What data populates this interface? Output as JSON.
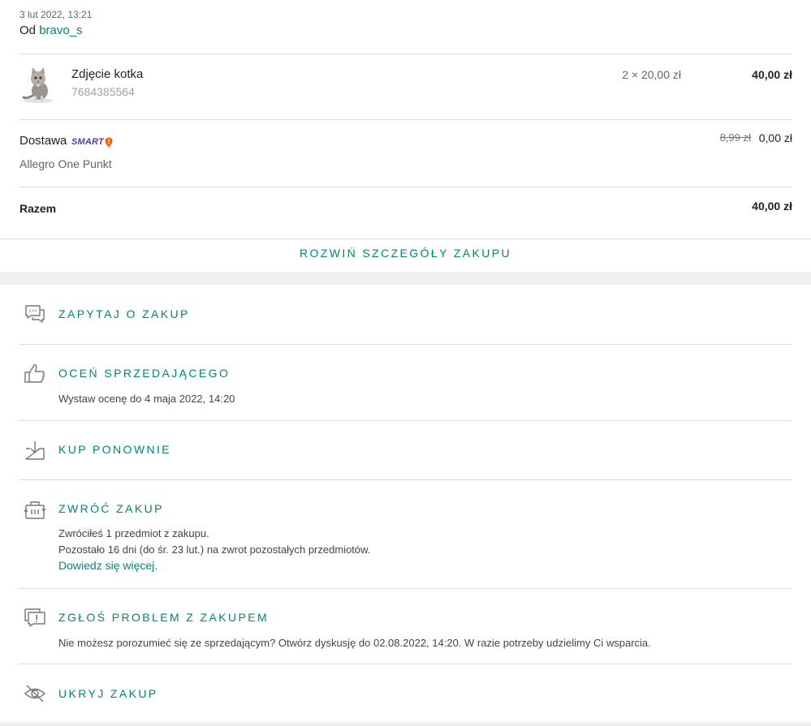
{
  "order": {
    "date": "3 lut 2022, 13:21",
    "from_prefix": "Od",
    "seller": "bravo_s"
  },
  "item": {
    "name": "Zdjęcie kotka",
    "id": "7684385564",
    "quantity_price": "2 × 20,00 zł",
    "total": "40,00 zł",
    "thumbnail_icon": "kitten-photo"
  },
  "delivery": {
    "label": "Dostawa",
    "badge": "SMART",
    "badge_icon": "smart-pin-icon",
    "method": "Allegro One Punkt",
    "old_price": "8,99 zł",
    "new_price": "0,00 zł"
  },
  "summary": {
    "label": "Razem",
    "total": "40,00 zł"
  },
  "expand_label": "ROZWIŃ SZCZEGÓŁY ZAKUPU",
  "actions": {
    "ask": {
      "title": "ZAPYTAJ O ZAKUP",
      "icon": "chat-bubbles-icon"
    },
    "rate": {
      "title": "OCEŃ SPRZEDAJĄCEGO",
      "desc": "Wystaw ocenę do 4 maja 2022, 14:20",
      "icon": "thumbs-up-icon"
    },
    "rebuy": {
      "title": "KUP PONOWNIE",
      "icon": "basket-download-icon"
    },
    "return": {
      "title": "ZWRÓĆ ZAKUP",
      "desc1": "Zwróciłeś 1 przedmiot z zakupu.",
      "desc2": "Pozostało 16 dni (do śr. 23 lut.) na zwrot pozostałych przedmiotów.",
      "link": "Dowiedz się więcej.",
      "icon": "return-box-icon"
    },
    "problem": {
      "title": "ZGŁOŚ PROBLEM Z ZAKUPEM",
      "desc": "Nie możesz porozumieć się ze sprzedającym? Otwórz dyskusję do 02.08.2022, 14:20. W razie potrzeby udzielimy Ci wsparcia.",
      "icon": "warning-chat-icon"
    },
    "hide": {
      "title": "UKRYJ ZAKUP",
      "icon": "eye-off-icon"
    }
  },
  "colors": {
    "accent": "#008673",
    "smart_purple": "#4b3fa0",
    "smart_orange": "#ff5a00",
    "divider": "#dcdcdc",
    "gap": "#f0f0f0"
  }
}
